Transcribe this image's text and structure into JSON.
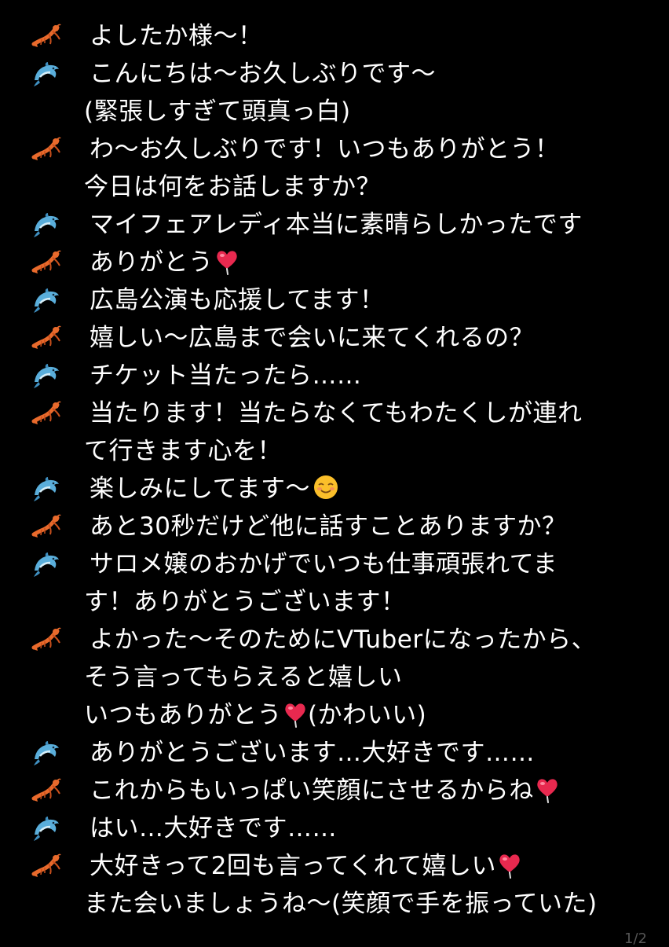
{
  "colors": {
    "background": "#000000",
    "text": "#ffffff",
    "heart": "#e8294f",
    "lobster": "#e86a2c",
    "dolphin": "#5aaedb",
    "smile": "#fbbf2a"
  },
  "speakers": {
    "host": "lobster-icon",
    "fan": "dolphin-icon"
  },
  "messages": [
    {
      "speaker": "host",
      "lines": [
        "よしたか様〜！"
      ]
    },
    {
      "speaker": "fan",
      "lines": [
        "こんにちは〜お久しぶりです〜",
        "(緊張しすぎて頭真っ白)"
      ]
    },
    {
      "speaker": "host",
      "lines": [
        "わ〜お久しぶりです！いつもありがとう！",
        "今日は何をお話しますか？"
      ]
    },
    {
      "speaker": "fan",
      "lines": [
        "マイフェアレディ本当に素晴らしかったです"
      ]
    },
    {
      "speaker": "host",
      "lines": [
        "ありがとう"
      ],
      "emoji": "heart"
    },
    {
      "speaker": "fan",
      "lines": [
        "広島公演も応援してます！"
      ]
    },
    {
      "speaker": "host",
      "lines": [
        "嬉しい〜広島まで会いに来てくれるの？"
      ]
    },
    {
      "speaker": "fan",
      "lines": [
        "チケット当たったら……"
      ]
    },
    {
      "speaker": "host",
      "lines": [
        "当たります！当たらなくてもわたくしが連れ",
        "て行きます心を！"
      ]
    },
    {
      "speaker": "fan",
      "lines": [
        "楽しみにしてます〜"
      ],
      "emoji": "smile"
    },
    {
      "speaker": "host",
      "lines": [
        "あと30秒だけど他に話すことありますか？"
      ]
    },
    {
      "speaker": "fan",
      "lines": [
        "サロメ嬢のおかげでいつも仕事頑張れてま",
        "す！ありがとうございます！"
      ]
    },
    {
      "speaker": "host",
      "lines": [
        "よかった〜そのためにVTuberになったから、",
        "そう言ってもらえると嬉しい",
        "いつもありがとう"
      ],
      "emoji": "heart",
      "suffix": "(かわいい)"
    },
    {
      "speaker": "fan",
      "lines": [
        "ありがとうございます…大好きです……"
      ]
    },
    {
      "speaker": "host",
      "lines": [
        "これからもいっぱい笑顔にさせるからね"
      ],
      "emoji": "heart"
    },
    {
      "speaker": "fan",
      "lines": [
        "はい…大好きです……"
      ]
    },
    {
      "speaker": "host",
      "lines": [
        "大好きって2回も言ってくれて嬉しい",
        "また会いましょうね〜(笑顔で手を振っていた)"
      ],
      "emoji_after_line": 0,
      "emoji": "heart"
    }
  ],
  "page_indicator": "1/2"
}
